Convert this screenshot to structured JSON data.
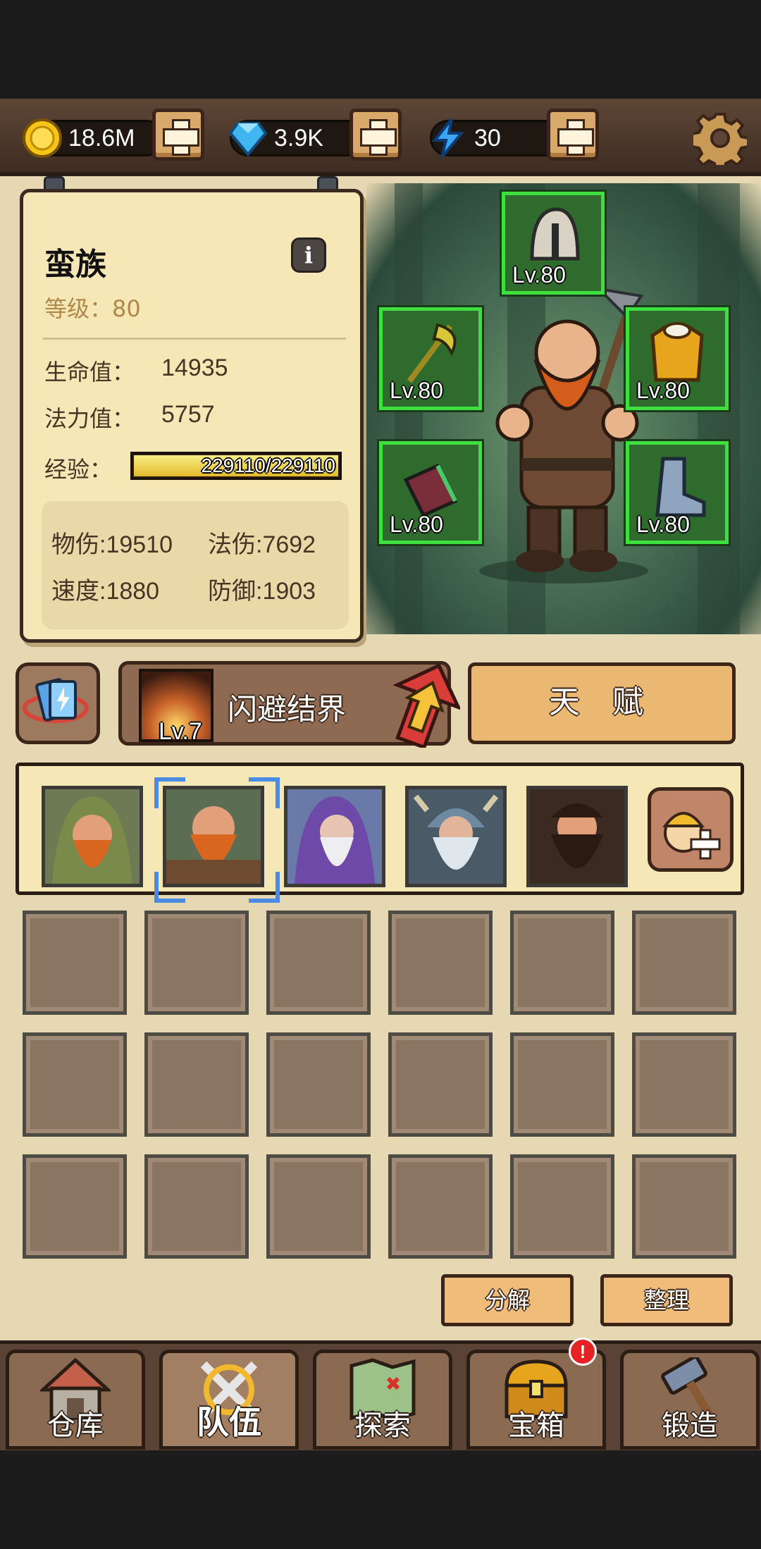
{
  "resources": {
    "gold": "18.6M",
    "diamonds": "3.9K",
    "energy": "30"
  },
  "hero": {
    "name": "蛮族",
    "level_label": "等级：",
    "level_value": "80",
    "hp_label": "生命值：",
    "hp_value": "14935",
    "mp_label": "法力值：",
    "mp_value": "5757",
    "xp_label": "经验：",
    "xp_text": "229110/229110",
    "xp_fraction": 1.0,
    "phys_atk": "物伤:19510",
    "mag_atk": "法伤:7692",
    "speed": "速度:1880",
    "defense": "防御:1903"
  },
  "equipment": [
    {
      "slot": "helmet",
      "level": "Lv.80"
    },
    {
      "slot": "weapon",
      "level": "Lv.80"
    },
    {
      "slot": "armor",
      "level": "Lv.80"
    },
    {
      "slot": "bracer",
      "level": "Lv.80"
    },
    {
      "slot": "boots",
      "level": "Lv.80"
    }
  ],
  "skill": {
    "name": "闪避结界",
    "level": "Lv.7"
  },
  "talent_label": "天 赋",
  "team": {
    "selected_index": 1
  },
  "inventory": {
    "rows": 3,
    "cols": 6
  },
  "actions": {
    "decompose": "分解",
    "sort": "整理"
  },
  "nav": [
    {
      "label": "仓库",
      "active": false
    },
    {
      "label": "队伍",
      "active": true
    },
    {
      "label": "探索",
      "active": false
    },
    {
      "label": "宝箱",
      "active": false,
      "badge": "!"
    },
    {
      "label": "锻造",
      "active": false
    }
  ],
  "colors": {
    "equip_frame": "#3ee040",
    "selection": "#4a8be6",
    "badge": "#e62222"
  }
}
